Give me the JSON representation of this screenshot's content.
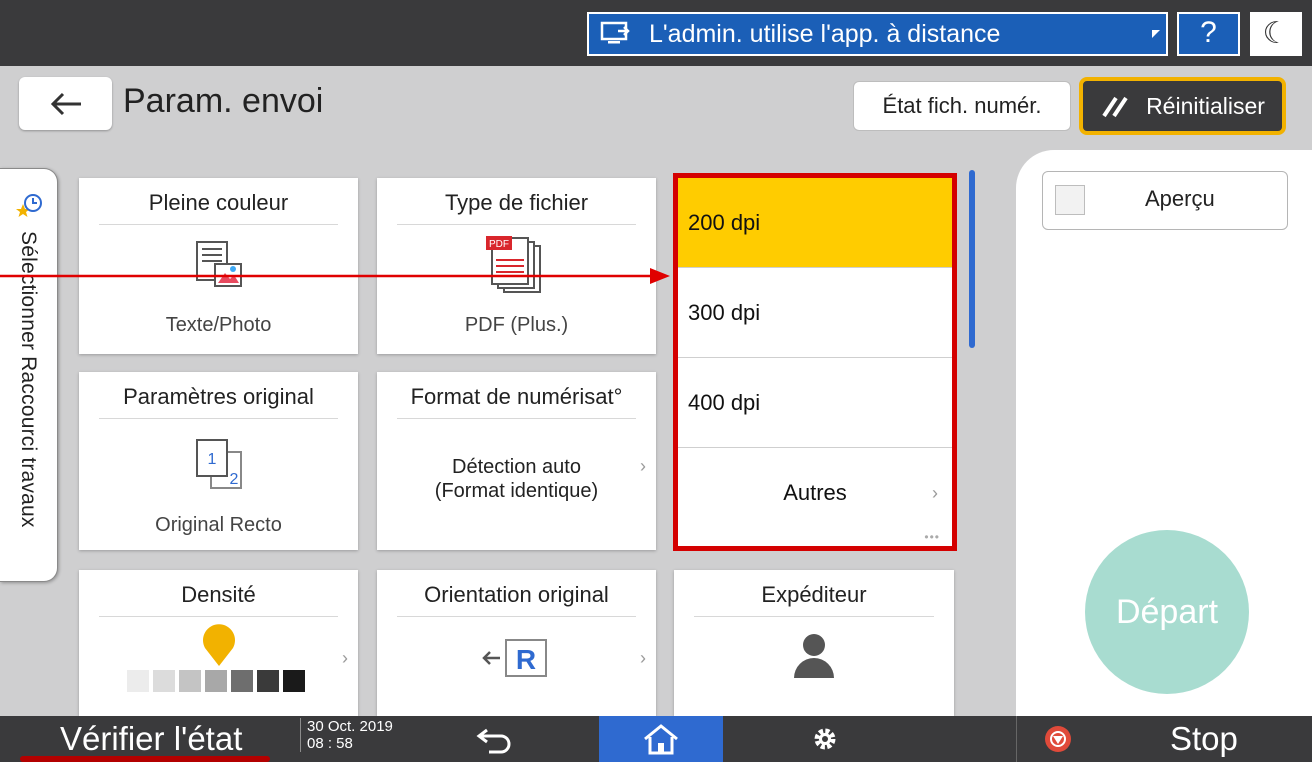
{
  "topbar": {
    "remote_banner_text": "L'admin. utilise l'app. à distance",
    "help_label": "?",
    "night_icon": "moon-icon"
  },
  "header": {
    "title": "Param. envoi",
    "state_button": "État fich. numér.",
    "reset_button": "Réinitialiser"
  },
  "side_tab": {
    "label": "Sélectionner Raccourci travaux"
  },
  "tiles": {
    "color": {
      "title": "Pleine couleur",
      "value": "Texte/Photo"
    },
    "file_type": {
      "title": "Type de fichier",
      "value": "PDF (Plus.)",
      "icon_text": "PDF"
    },
    "original": {
      "title": "Paramètres original",
      "value": "Original Recto",
      "page1": "1",
      "page2": "2"
    },
    "scan_size": {
      "title": "Format de numérisat°",
      "value_line1": "Détection auto",
      "value_line2": "(Format identique)"
    },
    "density": {
      "title": "Densité",
      "level_fraction": 0.5
    },
    "orientation": {
      "title": "Orientation original",
      "icon_letter": "R"
    },
    "sender": {
      "title": "Expéditeur"
    }
  },
  "resolution": {
    "options": [
      "200 dpi",
      "300 dpi",
      "400 dpi"
    ],
    "selected": "200 dpi",
    "more_label": "Autres"
  },
  "right_panel": {
    "preview_label": "Aperçu",
    "start_label": "Départ"
  },
  "bottombar": {
    "check_status": "Vérifier l'état",
    "date": "30 Oct. 2019",
    "time": "08 : 58",
    "stop_label": "Stop"
  },
  "colors": {
    "accent_blue": "#2f6ad0",
    "selected_yellow": "#ffcc00",
    "highlight_red": "#d40000",
    "start_teal": "#a8dcd0"
  }
}
